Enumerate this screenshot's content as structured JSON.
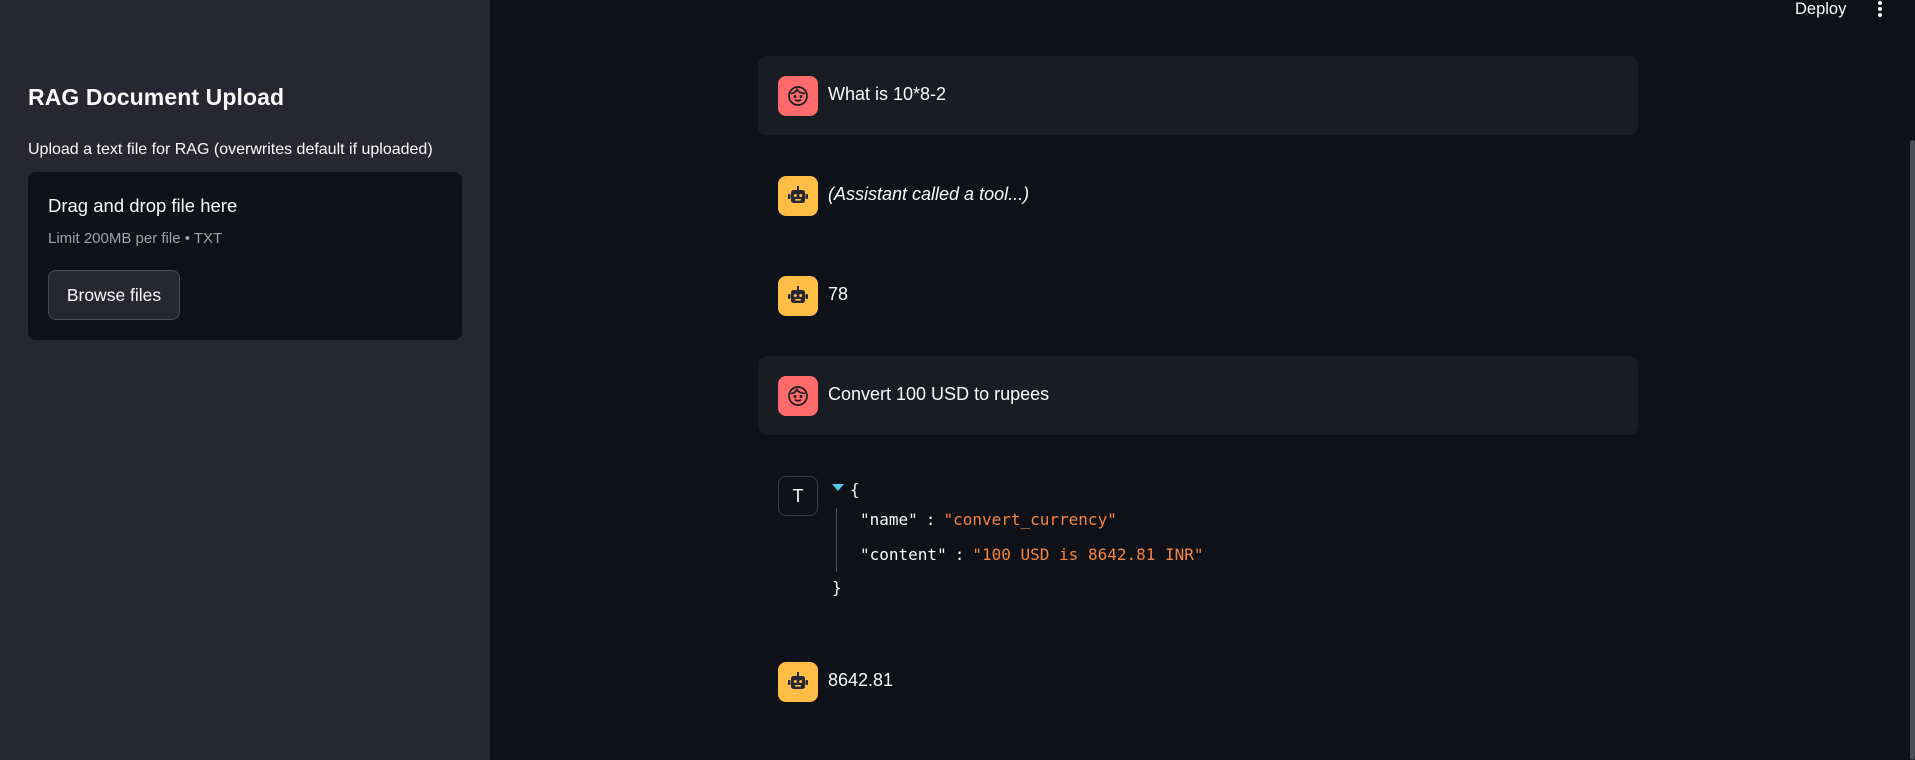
{
  "sidebar": {
    "title": "RAG Document Upload",
    "uploader": {
      "label": "Upload a text file for RAG (overwrites default if uploaded)",
      "drop_title": "Drag and drop file here",
      "drop_subtitle": "Limit 200MB per file • TXT",
      "browse_label": "Browse files"
    }
  },
  "header": {
    "deploy_label": "Deploy",
    "menu_icon": "kebab-menu-icon"
  },
  "chat": {
    "messages": [
      {
        "role": "user",
        "icon": "user-avatar-icon",
        "text": "What is 10*8-2"
      },
      {
        "role": "assistant",
        "icon": "robot-avatar-icon",
        "text": "(Assistant called a tool...)"
      },
      {
        "role": "assistant",
        "icon": "robot-avatar-icon",
        "text": "78"
      },
      {
        "role": "user",
        "icon": "user-avatar-icon",
        "text": "Convert 100 USD to rupees"
      },
      {
        "role": "tool",
        "avatar_letter": "T",
        "json": {
          "open": "{",
          "close": "}",
          "entries": [
            {
              "key": "\"name\"",
              "colon": ":",
              "value": "\"convert_currency\""
            },
            {
              "key": "\"content\"",
              "colon": ":",
              "value": "\"100 USD is 8642.81 INR\""
            }
          ]
        }
      },
      {
        "role": "assistant",
        "icon": "robot-avatar-icon",
        "text": "8642.81"
      }
    ]
  },
  "colors": {
    "app_bg": "#0e1117",
    "sidebar_bg": "#262730",
    "user_avatar": "#ff6b6b",
    "assistant_avatar": "#ffbd45",
    "json_value": "#f5843c",
    "json_caret": "#57c7e3"
  }
}
